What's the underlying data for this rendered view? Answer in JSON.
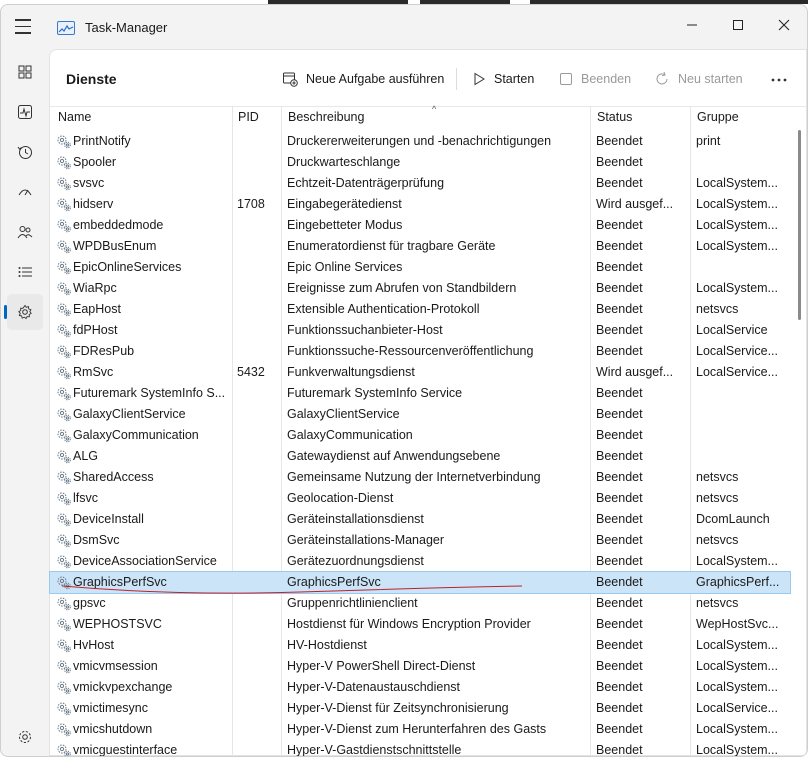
{
  "window": {
    "title": "Task-Manager"
  },
  "toolbar": {
    "page_title": "Dienste",
    "new_task": "Neue Aufgabe ausführen",
    "start": "Starten",
    "stop": "Beenden",
    "restart": "Neu starten",
    "more": "..."
  },
  "columns": {
    "name": "Name",
    "pid": "PID",
    "description": "Beschreibung",
    "status": "Status",
    "group": "Gruppe"
  },
  "rows": [
    {
      "name": "PrintNotify",
      "pid": "",
      "description": "Druckererweiterungen und -benachrichtigungen",
      "status": "Beendet",
      "group": "print"
    },
    {
      "name": "Spooler",
      "pid": "",
      "description": "Druckwarteschlange",
      "status": "Beendet",
      "group": ""
    },
    {
      "name": "svsvc",
      "pid": "",
      "description": "Echtzeit-Datenträgerprüfung",
      "status": "Beendet",
      "group": "LocalSystem..."
    },
    {
      "name": "hidserv",
      "pid": "1708",
      "description": "Eingabegerätedienst",
      "status": "Wird ausgef...",
      "group": "LocalSystem..."
    },
    {
      "name": "embeddedmode",
      "pid": "",
      "description": "Eingebetteter Modus",
      "status": "Beendet",
      "group": "LocalSystem..."
    },
    {
      "name": "WPDBusEnum",
      "pid": "",
      "description": "Enumeratordienst für tragbare Geräte",
      "status": "Beendet",
      "group": "LocalSystem..."
    },
    {
      "name": "EpicOnlineServices",
      "pid": "",
      "description": "Epic Online Services",
      "status": "Beendet",
      "group": ""
    },
    {
      "name": "WiaRpc",
      "pid": "",
      "description": "Ereignisse zum Abrufen von Standbildern",
      "status": "Beendet",
      "group": "LocalSystem..."
    },
    {
      "name": "EapHost",
      "pid": "",
      "description": "Extensible Authentication-Protokoll",
      "status": "Beendet",
      "group": "netsvcs"
    },
    {
      "name": "fdPHost",
      "pid": "",
      "description": "Funktionssuchanbieter-Host",
      "status": "Beendet",
      "group": "LocalService"
    },
    {
      "name": "FDResPub",
      "pid": "",
      "description": "Funktionssuche-Ressourcenveröffentlichung",
      "status": "Beendet",
      "group": "LocalService..."
    },
    {
      "name": "RmSvc",
      "pid": "5432",
      "description": "Funkverwaltungsdienst",
      "status": "Wird ausgef...",
      "group": "LocalService..."
    },
    {
      "name": "Futuremark SystemInfo S...",
      "pid": "",
      "description": "Futuremark SystemInfo Service",
      "status": "Beendet",
      "group": ""
    },
    {
      "name": "GalaxyClientService",
      "pid": "",
      "description": "GalaxyClientService",
      "status": "Beendet",
      "group": ""
    },
    {
      "name": "GalaxyCommunication",
      "pid": "",
      "description": "GalaxyCommunication",
      "status": "Beendet",
      "group": ""
    },
    {
      "name": "ALG",
      "pid": "",
      "description": "Gatewaydienst auf Anwendungsebene",
      "status": "Beendet",
      "group": ""
    },
    {
      "name": "SharedAccess",
      "pid": "",
      "description": "Gemeinsame Nutzung der Internetverbindung",
      "status": "Beendet",
      "group": "netsvcs"
    },
    {
      "name": "lfsvc",
      "pid": "",
      "description": "Geolocation-Dienst",
      "status": "Beendet",
      "group": "netsvcs"
    },
    {
      "name": "DeviceInstall",
      "pid": "",
      "description": "Geräteinstallationsdienst",
      "status": "Beendet",
      "group": "DcomLaunch"
    },
    {
      "name": "DsmSvc",
      "pid": "",
      "description": "Geräteinstallations-Manager",
      "status": "Beendet",
      "group": "netsvcs"
    },
    {
      "name": "DeviceAssociationService",
      "pid": "",
      "description": "Gerätezuordnungsdienst",
      "status": "Beendet",
      "group": "LocalSystem..."
    },
    {
      "name": "GraphicsPerfSvc",
      "pid": "",
      "description": "GraphicsPerfSvc",
      "status": "Beendet",
      "group": "GraphicsPerf...",
      "selected": true
    },
    {
      "name": "gpsvc",
      "pid": "",
      "description": "Gruppenrichtlinienclient",
      "status": "Beendet",
      "group": "netsvcs"
    },
    {
      "name": "WEPHOSTSVC",
      "pid": "",
      "description": "Hostdienst für Windows Encryption Provider",
      "status": "Beendet",
      "group": "WepHostSvc..."
    },
    {
      "name": "HvHost",
      "pid": "",
      "description": "HV-Hostdienst",
      "status": "Beendet",
      "group": "LocalSystem..."
    },
    {
      "name": "vmicvmsession",
      "pid": "",
      "description": "Hyper-V PowerShell Direct-Dienst",
      "status": "Beendet",
      "group": "LocalSystem..."
    },
    {
      "name": "vmickvpexchange",
      "pid": "",
      "description": "Hyper-V-Datenaustauschdienst",
      "status": "Beendet",
      "group": "LocalSystem..."
    },
    {
      "name": "vmictimesync",
      "pid": "",
      "description": "Hyper-V-Dienst für Zeitsynchronisierung",
      "status": "Beendet",
      "group": "LocalService..."
    },
    {
      "name": "vmicshutdown",
      "pid": "",
      "description": "Hyper-V-Dienst zum Herunterfahren des Gasts",
      "status": "Beendet",
      "group": "LocalSystem..."
    },
    {
      "name": "vmicguestinterface",
      "pid": "",
      "description": "Hyper-V-Gastdienstschnittstelle",
      "status": "Beendet",
      "group": "LocalSystem..."
    }
  ],
  "nav": [
    "menu-icon",
    "processes-icon",
    "performance-icon",
    "app-history-icon",
    "startup-apps-icon",
    "users-icon",
    "details-icon",
    "services-icon",
    "settings-icon"
  ],
  "colors": {
    "accent": "#0067c0",
    "selected_row": "#cce4f7",
    "annotation_line": "#c0202a"
  }
}
